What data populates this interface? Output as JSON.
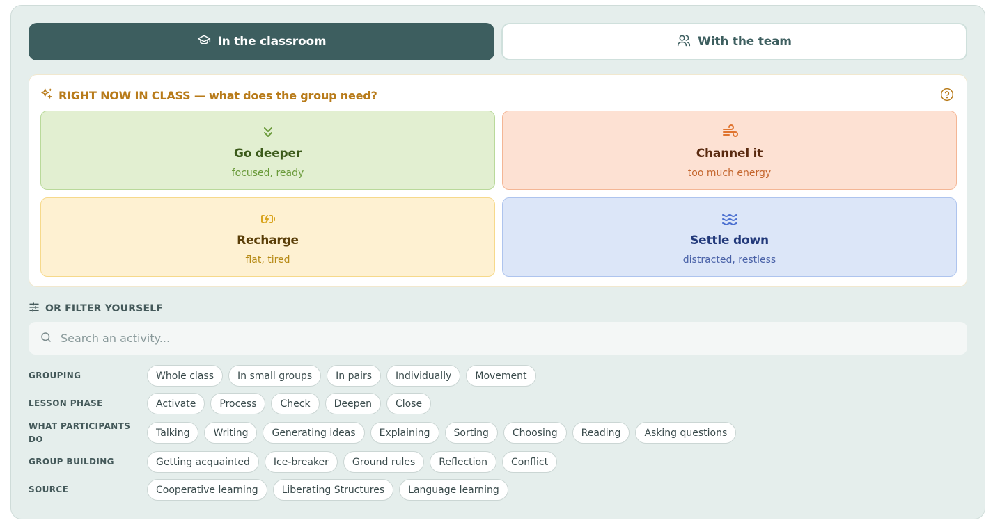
{
  "tabs": {
    "classroom": {
      "label": "In the classroom",
      "icon": "graduation-cap-icon",
      "active": true
    },
    "team": {
      "label": "With the team",
      "icon": "users-icon",
      "active": false
    }
  },
  "right_now": {
    "title": "RIGHT NOW IN CLASS — what does the group need?",
    "icon": "sparkles-icon",
    "help_icon": "help-circle-icon",
    "moods": {
      "deeper": {
        "label": "Go deeper",
        "sub": "focused, ready",
        "icon": "chevrons-down-icon",
        "color": "#6a9a3a"
      },
      "channel": {
        "label": "Channel it",
        "sub": "too much energy",
        "icon": "wind-icon",
        "color": "#e0742f"
      },
      "recharge": {
        "label": "Recharge",
        "sub": "flat, tired",
        "icon": "battery-charging-icon",
        "color": "#d9a520"
      },
      "settle": {
        "label": "Settle down",
        "sub": "distracted, restless",
        "icon": "waves-icon",
        "color": "#4a6fd0"
      }
    }
  },
  "filter": {
    "heading": "OR FILTER YOURSELF",
    "heading_icon": "sliders-icon",
    "search_placeholder": "Search an activity...",
    "rows": {
      "grouping": {
        "label": "GROUPING",
        "chips": [
          "Whole class",
          "In small groups",
          "In pairs",
          "Individually",
          "Movement"
        ]
      },
      "phase": {
        "label": "LESSON PHASE",
        "chips": [
          "Activate",
          "Process",
          "Check",
          "Deepen",
          "Close"
        ]
      },
      "participants": {
        "label": "WHAT PARTICIPANTS DO",
        "chips": [
          "Talking",
          "Writing",
          "Generating ideas",
          "Explaining",
          "Sorting",
          "Choosing",
          "Reading",
          "Asking questions"
        ]
      },
      "building": {
        "label": "GROUP BUILDING",
        "chips": [
          "Getting acquainted",
          "Ice-breaker",
          "Ground rules",
          "Reflection",
          "Conflict"
        ]
      },
      "source": {
        "label": "SOURCE",
        "chips": [
          "Cooperative learning",
          "Liberating Structures",
          "Language learning"
        ]
      }
    }
  }
}
